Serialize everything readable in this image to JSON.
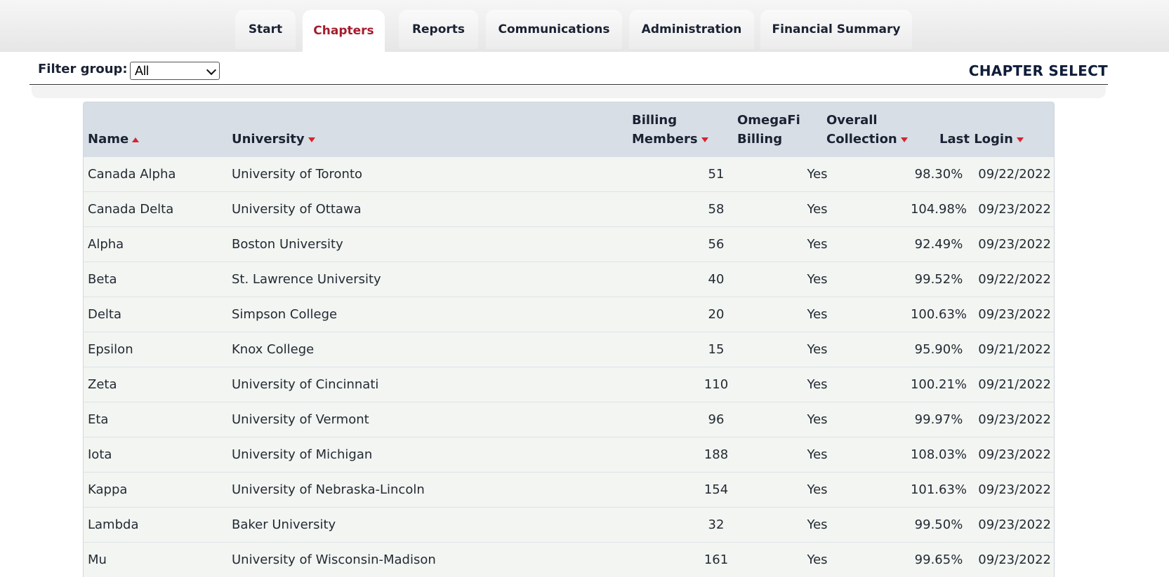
{
  "nav": {
    "tabs": [
      {
        "label": "Start",
        "active": false
      },
      {
        "label": "Chapters",
        "active": true
      },
      {
        "label": "Reports",
        "active": false
      },
      {
        "label": "Communications",
        "active": false
      },
      {
        "label": "Administration",
        "active": false
      },
      {
        "label": "Financial Summary",
        "active": false
      }
    ],
    "active_color": "#a31d2d"
  },
  "filter": {
    "label": "Filter group:",
    "selected": "All"
  },
  "page_title": "CHAPTER SELECT",
  "table": {
    "columns": [
      {
        "label": "Name",
        "sort": "asc"
      },
      {
        "label": "University",
        "sort": "desc"
      },
      {
        "label_line1": "Billing",
        "label_line2": "Members",
        "sort": "desc"
      },
      {
        "label_line1": "OmegaFi",
        "label_line2": "Billing",
        "sort": "none"
      },
      {
        "label_line1": "Overall",
        "label_line2": "Collection",
        "sort": "desc"
      },
      {
        "label": "Last Login",
        "sort": "desc"
      }
    ],
    "sort_arrow_color": "#d8222f",
    "rows": [
      {
        "name": "Canada Alpha",
        "university": "University of Toronto",
        "members": "51",
        "billing": "Yes",
        "collection": "98.30%",
        "last_login": "09/22/2022"
      },
      {
        "name": "Canada Delta",
        "university": "University of Ottawa",
        "members": "58",
        "billing": "Yes",
        "collection": "104.98%",
        "last_login": "09/23/2022"
      },
      {
        "name": "Alpha",
        "university": "Boston University",
        "members": "56",
        "billing": "Yes",
        "collection": "92.49%",
        "last_login": "09/23/2022"
      },
      {
        "name": "Beta",
        "university": "St. Lawrence University",
        "members": "40",
        "billing": "Yes",
        "collection": "99.52%",
        "last_login": "09/22/2022"
      },
      {
        "name": "Delta",
        "university": "Simpson College",
        "members": "20",
        "billing": "Yes",
        "collection": "100.63%",
        "last_login": "09/23/2022"
      },
      {
        "name": "Epsilon",
        "university": "Knox College",
        "members": "15",
        "billing": "Yes",
        "collection": "95.90%",
        "last_login": "09/21/2022"
      },
      {
        "name": "Zeta",
        "university": "University of Cincinnati",
        "members": "110",
        "billing": "Yes",
        "collection": "100.21%",
        "last_login": "09/21/2022"
      },
      {
        "name": "Eta",
        "university": "University of Vermont",
        "members": "96",
        "billing": "Yes",
        "collection": "99.97%",
        "last_login": "09/23/2022"
      },
      {
        "name": "Iota",
        "university": "University of Michigan",
        "members": "188",
        "billing": "Yes",
        "collection": "108.03%",
        "last_login": "09/23/2022"
      },
      {
        "name": "Kappa",
        "university": "University of Nebraska-Lincoln",
        "members": "154",
        "billing": "Yes",
        "collection": "101.63%",
        "last_login": "09/23/2022"
      },
      {
        "name": "Lambda",
        "university": "Baker University",
        "members": "32",
        "billing": "Yes",
        "collection": "99.50%",
        "last_login": "09/23/2022"
      },
      {
        "name": "Mu",
        "university": "University of Wisconsin-Madison",
        "members": "161",
        "billing": "Yes",
        "collection": "99.65%",
        "last_login": "09/23/2022"
      }
    ]
  }
}
